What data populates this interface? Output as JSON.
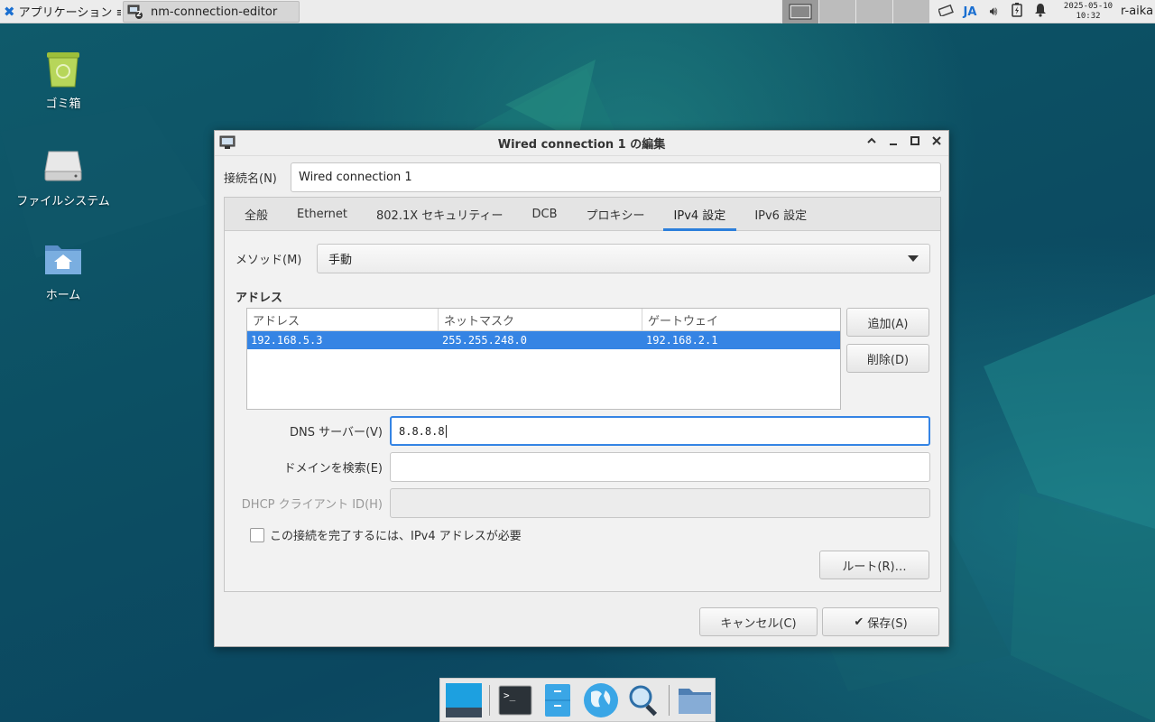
{
  "top_panel": {
    "apps_menu_label": "アプリケーション ≡",
    "task_title": "nm-connection-editor",
    "task_count": "2",
    "ime_label": "JA",
    "clock_date": "2025-05-10",
    "clock_time": "10:32",
    "user": "r-aika"
  },
  "desktop_icons": [
    {
      "label": "ゴミ箱",
      "icon": "trash-icon"
    },
    {
      "label": "ファイルシステム",
      "icon": "drive-icon"
    },
    {
      "label": "ホーム",
      "icon": "home-folder-icon"
    }
  ],
  "dialog": {
    "title": "Wired connection 1 の編集",
    "name_label": "接続名(N)",
    "name_value": "Wired connection 1",
    "tabs": [
      "全般",
      "Ethernet",
      "802.1X セキュリティー",
      "DCB",
      "プロキシー",
      "IPv4 設定",
      "IPv6 設定"
    ],
    "active_tab": "IPv4 設定",
    "method_label": "メソッド(M)",
    "method_value": "手動",
    "address_section_label": "アドレス",
    "address_columns": [
      "アドレス",
      "ネットマスク",
      "ゲートウェイ"
    ],
    "address_rows": [
      {
        "address": "192.168.5.3",
        "netmask": "255.255.248.0",
        "gateway": "192.168.2.1"
      }
    ],
    "add_button": "追加(A)",
    "delete_button": "削除(D)",
    "dns_label": "DNS サーバー(V)",
    "dns_value": "8.8.8.8",
    "search_domain_label": "ドメインを検索(E)",
    "search_domain_value": "",
    "dhcp_client_id_label": "DHCP クライアント ID(H)",
    "dhcp_client_id_value": "",
    "require_ipv4_label": "この接続を完了するには、IPv4 アドレスが必要",
    "routes_button": "ルート(R)…",
    "cancel_button": "キャンセル(C)",
    "save_button": "保存(S)"
  },
  "colors": {
    "accent": "#3584e4",
    "desktop": "#0e4a5c",
    "panel": "#ececec"
  }
}
